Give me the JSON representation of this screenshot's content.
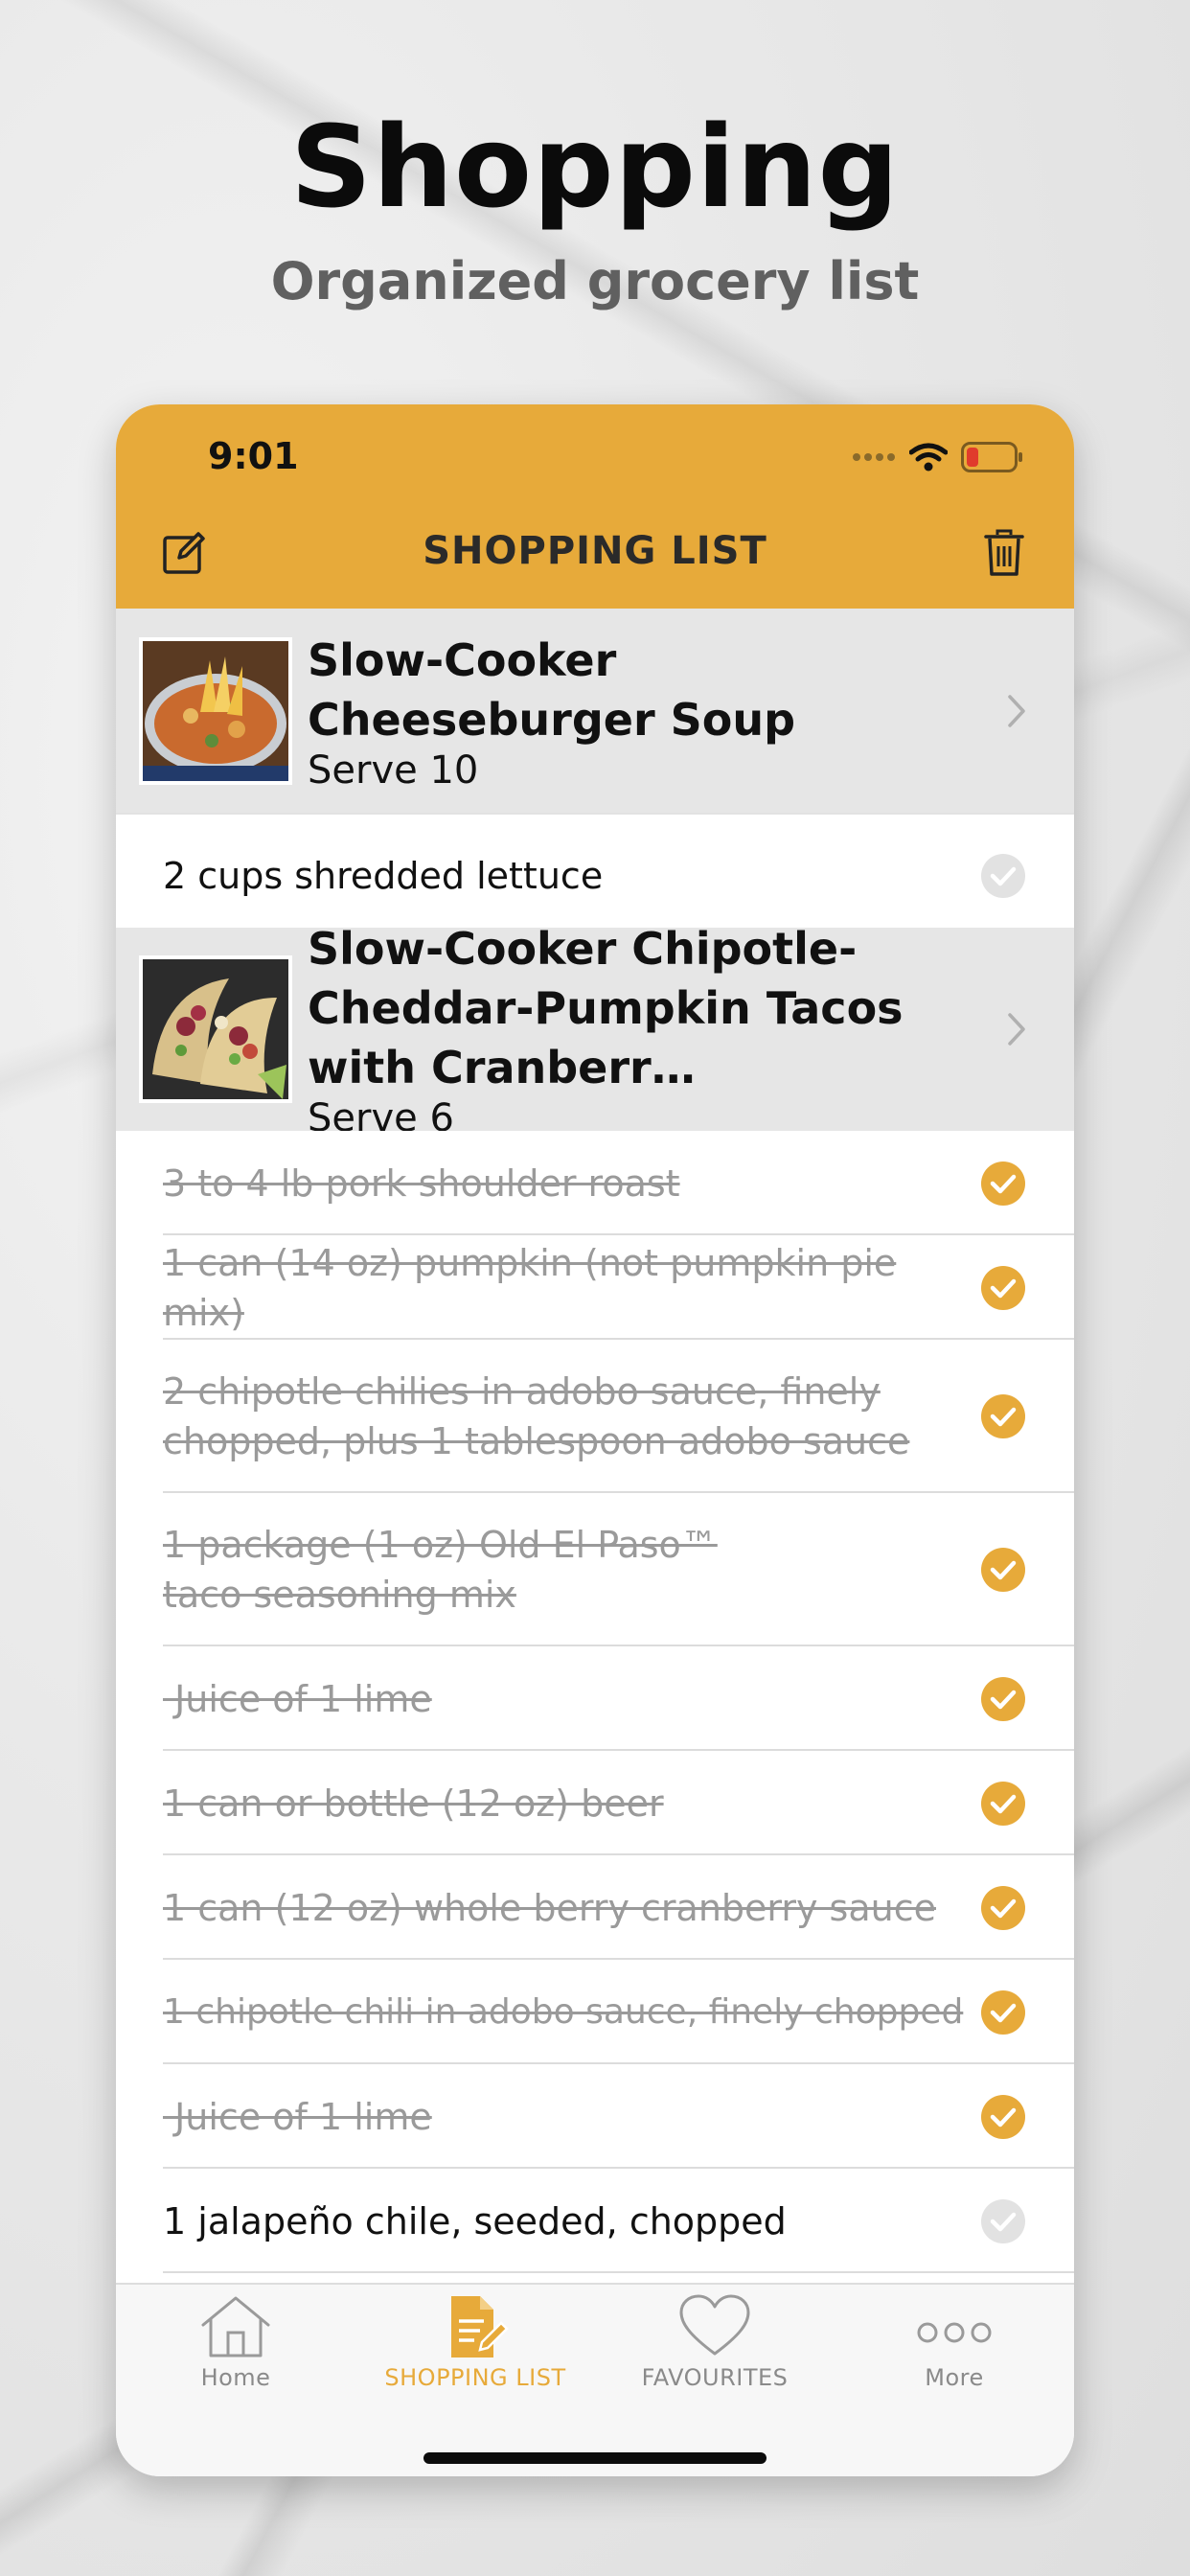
{
  "promo": {
    "title": "Shopping",
    "subtitle": "Organized grocery list"
  },
  "status_bar": {
    "time": "9:01"
  },
  "nav": {
    "title": "SHOPPING LIST",
    "left_icon": "edit-icon",
    "right_icon": "trash-icon"
  },
  "colors": {
    "accent": "#e7aa3a",
    "done_text": "#9a9a9a",
    "unchecked": "#e2e2e2"
  },
  "recipes": [
    {
      "name": "Slow-Cooker Cheeseburger Soup",
      "serve": "Serve 10",
      "items": [
        {
          "text": "2 cups shredded lettuce",
          "checked": false
        }
      ]
    },
    {
      "name": "Slow-Cooker Chipotle-Cheddar-Pumpkin Tacos with Cranberr…",
      "serve": "Serve 6",
      "items": [
        {
          "text": "3 to 4 lb pork shoulder roast",
          "checked": true
        },
        {
          "text": "1 can (14 oz) pumpkin (not pumpkin pie mix)",
          "checked": true
        },
        {
          "text": "2 chipotle chilies in adobo sauce, finely chopped, plus 1 tablespoon adobo sauce",
          "checked": true
        },
        {
          "text": "1 package (1 oz) Old El Paso™ taco seasoning mix",
          "checked": true
        },
        {
          "text": " Juice of 1 lime",
          "checked": true
        },
        {
          "text": "1 can or bottle (12 oz) beer",
          "checked": true
        },
        {
          "text": "1 can (12 oz) whole berry cranberry sauce",
          "checked": true
        },
        {
          "text": "1 chipotle chili in adobo sauce, finely chopped",
          "checked": true
        },
        {
          "text": " Juice of 1 lime",
          "checked": true
        },
        {
          "text": "1 jalapeño chile, seeded, chopped",
          "checked": false
        }
      ]
    }
  ],
  "tabbar": {
    "tabs": [
      {
        "label": "Home",
        "icon": "home-icon",
        "active": false
      },
      {
        "label": "SHOPPING LIST",
        "icon": "shopping-list-icon",
        "active": true
      },
      {
        "label": "FAVOURITES",
        "icon": "heart-icon",
        "active": false
      },
      {
        "label": "More",
        "icon": "more-icon",
        "active": false
      }
    ]
  }
}
